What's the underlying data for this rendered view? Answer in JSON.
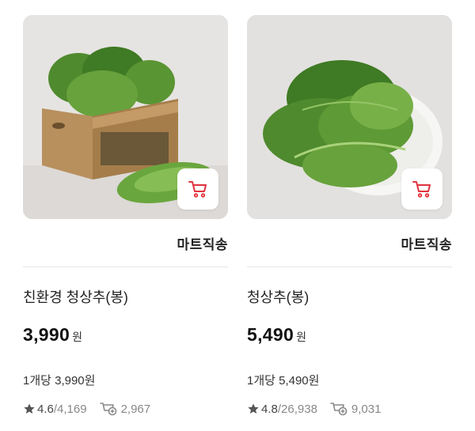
{
  "products": [
    {
      "image_alt": "lettuce-in-wooden-crate",
      "delivery_label": "마트직송",
      "name": "친환경 청상추(봉)",
      "price": "3,990",
      "currency": "원",
      "unit_price": "1개당 3,990원",
      "rating": "4.6",
      "review_count": "/4,169",
      "wish_count": "2,967"
    },
    {
      "image_alt": "lettuce-on-white-plate",
      "delivery_label": "마트직송",
      "name": "청상추(봉)",
      "price": "5,490",
      "currency": "원",
      "unit_price": "1개당 5,490원",
      "rating": "4.8",
      "review_count": "/26,938",
      "wish_count": "9,031"
    }
  ],
  "icons": {
    "cart": "cart-icon",
    "star": "star-icon",
    "wish": "cart-plus-icon"
  },
  "colors": {
    "cart_accent": "#e0333f",
    "text_primary": "#222222",
    "text_muted": "#888888"
  }
}
